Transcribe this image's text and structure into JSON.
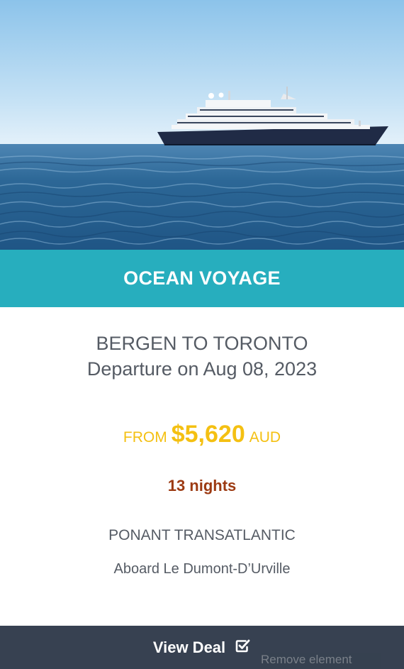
{
  "banner": {
    "title": "OCEAN VOYAGE"
  },
  "route": {
    "title": "BERGEN TO TORONTO",
    "departure": "Departure on Aug 08,  2023"
  },
  "price": {
    "prefix": "FROM",
    "amount": "$5,620",
    "currency": "AUD"
  },
  "nights": "13 nights",
  "operator": "PONANT TRANSATLANTIC",
  "ship": "Aboard Le Dumont-D’Urville",
  "cta": {
    "label": "View Deal",
    "icon": "check-square-icon"
  },
  "overlay": {
    "remove_label": "Remove element"
  },
  "colors": {
    "banner": "#27aebe",
    "price": "#f4c012",
    "nights": "#9c3a12",
    "footer": "#374151",
    "text": "#555b64"
  }
}
